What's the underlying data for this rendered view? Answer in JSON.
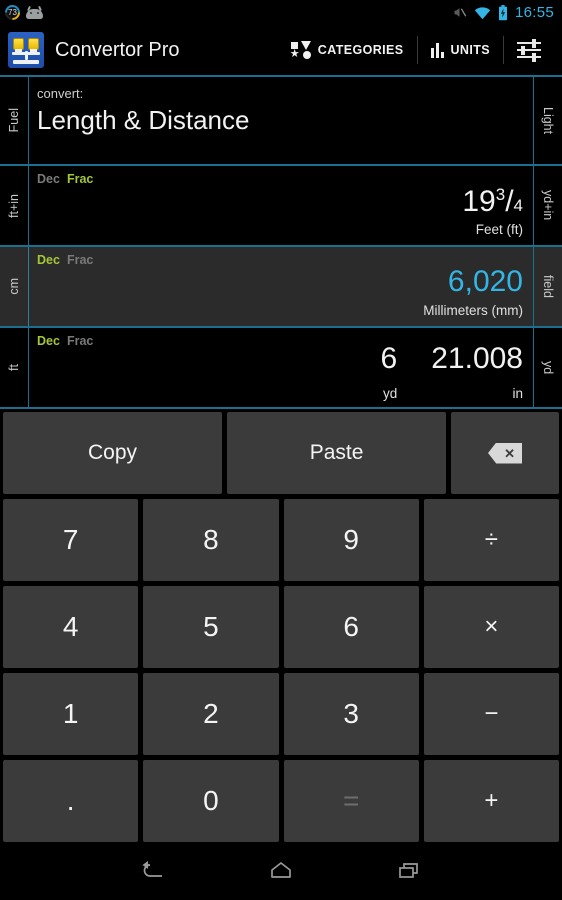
{
  "statusbar": {
    "badge_label": "73",
    "icons": [
      "score-badge-icon",
      "android-head-icon",
      "mute-icon",
      "wifi-icon",
      "battery-charging-icon"
    ],
    "time": "16:55",
    "accent_color": "#33b5e5"
  },
  "actionbar": {
    "app_title": "Convertor Pro",
    "categories_label": "CATEGORIES",
    "units_label": "UNITS",
    "settings_icon": "sliders-icon"
  },
  "convert_header": {
    "sub_label": "convert:",
    "title": "Length & Distance",
    "left_tab": "Fuel",
    "right_tab": "Light"
  },
  "rows": [
    {
      "left_tab": "ft+in",
      "right_tab": "yd+in",
      "dec_label": "Dec",
      "frac_label": "Frac",
      "mode": "Frac",
      "value_whole": "19",
      "value_numerator": "3",
      "value_denominator": "4",
      "unit": "Feet (ft)",
      "active": false
    },
    {
      "left_tab": "cm",
      "right_tab": "field",
      "dec_label": "Dec",
      "frac_label": "Frac",
      "mode": "Dec",
      "value": "6,020",
      "unit": "Millimeters (mm)",
      "active": true
    },
    {
      "left_tab": "ft",
      "right_tab": "yd",
      "dec_label": "Dec",
      "frac_label": "Frac",
      "mode": "Dec",
      "dual": [
        {
          "number": "6",
          "unit": "yd"
        },
        {
          "number": "21.008",
          "unit": "in"
        }
      ],
      "active": false
    }
  ],
  "keypad": {
    "copy_label": "Copy",
    "paste_label": "Paste",
    "backspace_icon": "backspace-icon",
    "keys": [
      [
        "7",
        "8",
        "9",
        "÷"
      ],
      [
        "4",
        "5",
        "6",
        "×"
      ],
      [
        "1",
        "2",
        "3",
        "−"
      ],
      [
        ".",
        "0",
        "=",
        "+"
      ]
    ],
    "equals_disabled": true
  },
  "navbar": {
    "back": "back-icon",
    "home": "home-icon",
    "recents": "recents-icon"
  },
  "colors": {
    "accent_blue": "#33b5e5",
    "active_green": "#a4c639",
    "divider": "#1b6f8f",
    "key_bg": "#3b3b3b",
    "row_active_bg": "#2b2b2b"
  }
}
